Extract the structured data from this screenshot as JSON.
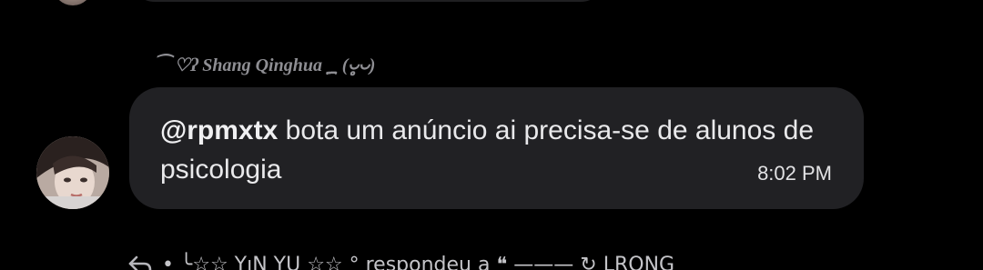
{
  "sender": {
    "name": "⁀ ♡ʔ Shang Qinghua ؁ (◡̥◡)"
  },
  "message": {
    "mention": "@rpmxtx",
    "body": " bota um anúncio ai precisa-se de alunos de psicologia",
    "time": "8:02 PM"
  },
  "reply": {
    "text": "• ╰☆☆ YıN YU ☆☆ ° respondeu a ❝ ——— ↻ LRONG"
  },
  "colors": {
    "background": "#000000",
    "bubble": "#212124",
    "text": "#e9e9eb",
    "muted": "#8a8a8e"
  },
  "icons": {
    "reply": "reply-arrow-icon",
    "swoosh": "swoosh-icon"
  }
}
